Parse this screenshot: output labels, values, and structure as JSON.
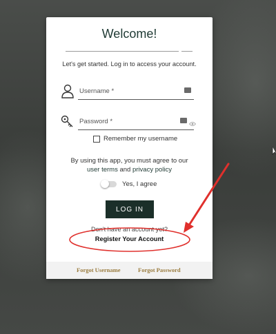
{
  "login": {
    "title": "Welcome!",
    "subtitle": "Let's get started. Log in to access your account.",
    "username_placeholder": "Username *",
    "password_placeholder": "Password *",
    "remember_label": "Remember my username",
    "agree_prefix": "By using this app, you must agree to our",
    "terms_link": "user terms",
    "and_text": "and",
    "privacy_link": "privacy policy",
    "agree_toggle_label": "Yes, I agree",
    "login_button": "LOG IN",
    "no_account_text": "Don't have an account yet?",
    "register_link": "Register Your Account"
  },
  "footer": {
    "forgot_username": "Forgot Username",
    "forgot_password": "Forgot Password"
  },
  "icons": {
    "username": "user-icon",
    "password": "key-icon",
    "autofill": "keyboard-icon",
    "reveal": "eye-icon"
  },
  "colors": {
    "primary": "#1b2f29",
    "footer_link": "#9a7c3f",
    "annotation": "#e0302c"
  }
}
